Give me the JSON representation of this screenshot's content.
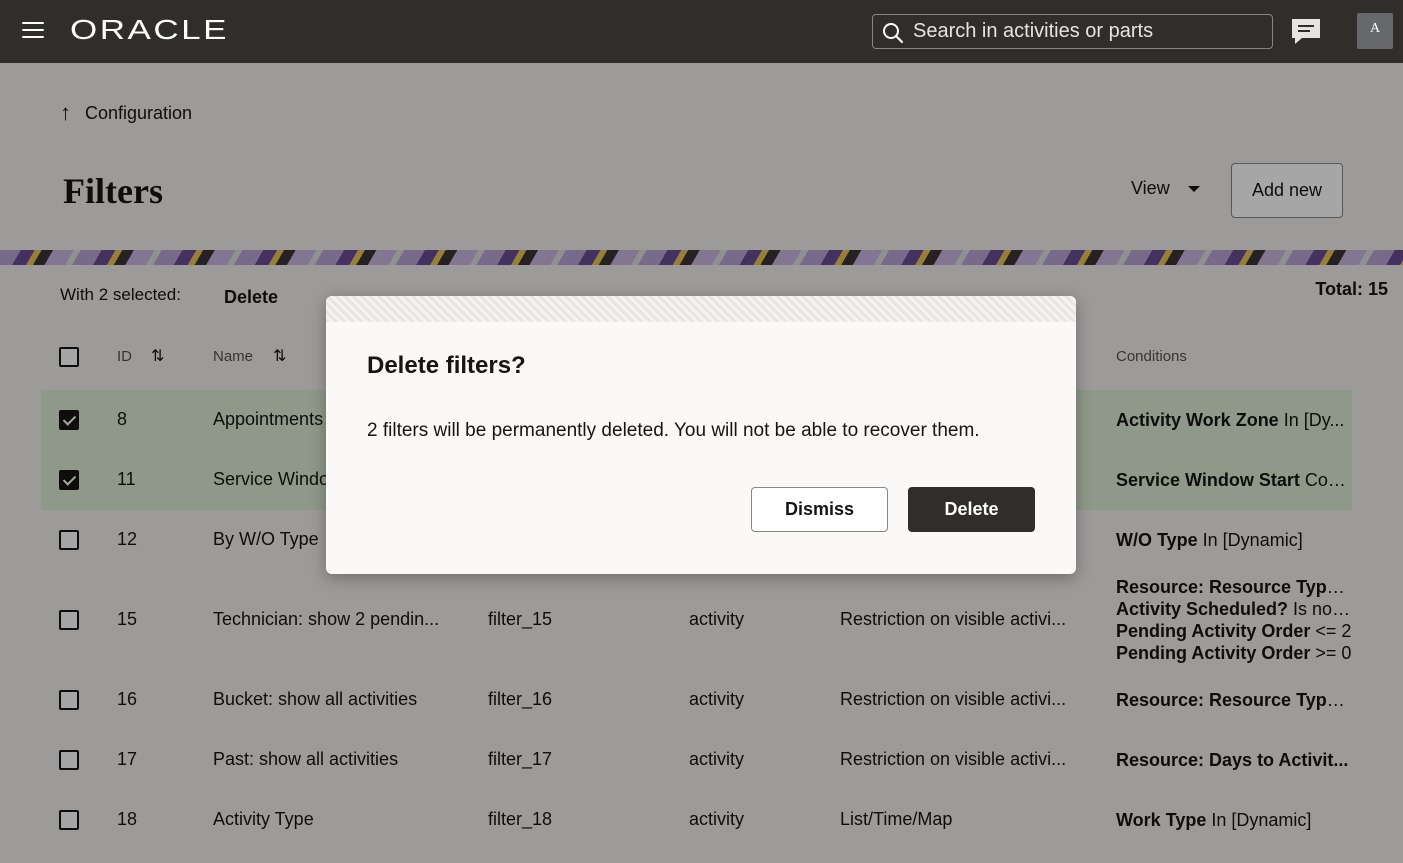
{
  "header": {
    "logo": "ORACLE",
    "search_placeholder": "Search in activities or parts",
    "avatar_initial": "A"
  },
  "breadcrumb": {
    "label": "Configuration"
  },
  "page": {
    "title": "Filters",
    "view_label": "View",
    "add_new_label": "Add new"
  },
  "selection": {
    "with_selected": "With 2 selected:",
    "delete_label": "Delete",
    "total": "Total: 15"
  },
  "table": {
    "columns": {
      "id": "ID",
      "name": "Name",
      "conditions": "Conditions"
    },
    "rows": [
      {
        "checked": true,
        "id": "8",
        "name": "Appointments",
        "label": "",
        "entity": "",
        "type": "",
        "conditions": [
          {
            "field": "Activity Work Zone",
            "rest": " In [Dy..."
          }
        ]
      },
      {
        "checked": true,
        "id": "11",
        "name": "Service Window",
        "label": "",
        "entity": "",
        "type": "",
        "conditions": [
          {
            "field": "Service Window Start",
            "rest": " Con..."
          }
        ]
      },
      {
        "checked": false,
        "id": "12",
        "name": "By W/O Type",
        "label": "",
        "entity": "",
        "type": "",
        "conditions": [
          {
            "field": "W/O Type",
            "rest": " In [Dynamic]"
          }
        ]
      },
      {
        "checked": false,
        "id": "15",
        "name": "Technician: show 2 pendin...",
        "label": "filter_15",
        "entity": "activity",
        "type": "Restriction on visible activi...",
        "conditions": [
          {
            "field": "Resource: Resource Type",
            "rest": " I..."
          },
          {
            "field": "Activity Scheduled?",
            "rest": " Is not..."
          },
          {
            "field": "Pending Activity Order",
            "rest": " <= 2"
          },
          {
            "field": "Pending Activity Order",
            "rest": " >= 0"
          }
        ]
      },
      {
        "checked": false,
        "id": "16",
        "name": "Bucket: show all activities",
        "label": "filter_16",
        "entity": "activity",
        "type": "Restriction on visible activi...",
        "conditions": [
          {
            "field": "Resource: Resource Type",
            "rest": " I..."
          }
        ]
      },
      {
        "checked": false,
        "id": "17",
        "name": "Past: show all activities",
        "label": "filter_17",
        "entity": "activity",
        "type": "Restriction on visible activi...",
        "conditions": [
          {
            "field": "Resource: Days to Activit...",
            "rest": ""
          }
        ]
      },
      {
        "checked": false,
        "id": "18",
        "name": "Activity Type",
        "label": "filter_18",
        "entity": "activity",
        "type": "List/Time/Map",
        "conditions": [
          {
            "field": "Work Type",
            "rest": " In [Dynamic]"
          }
        ]
      }
    ]
  },
  "dialog": {
    "title": "Delete filters?",
    "message": "2 filters will be permanently deleted. You will not be able to recover them.",
    "dismiss_label": "Dismiss",
    "confirm_label": "Delete"
  }
}
